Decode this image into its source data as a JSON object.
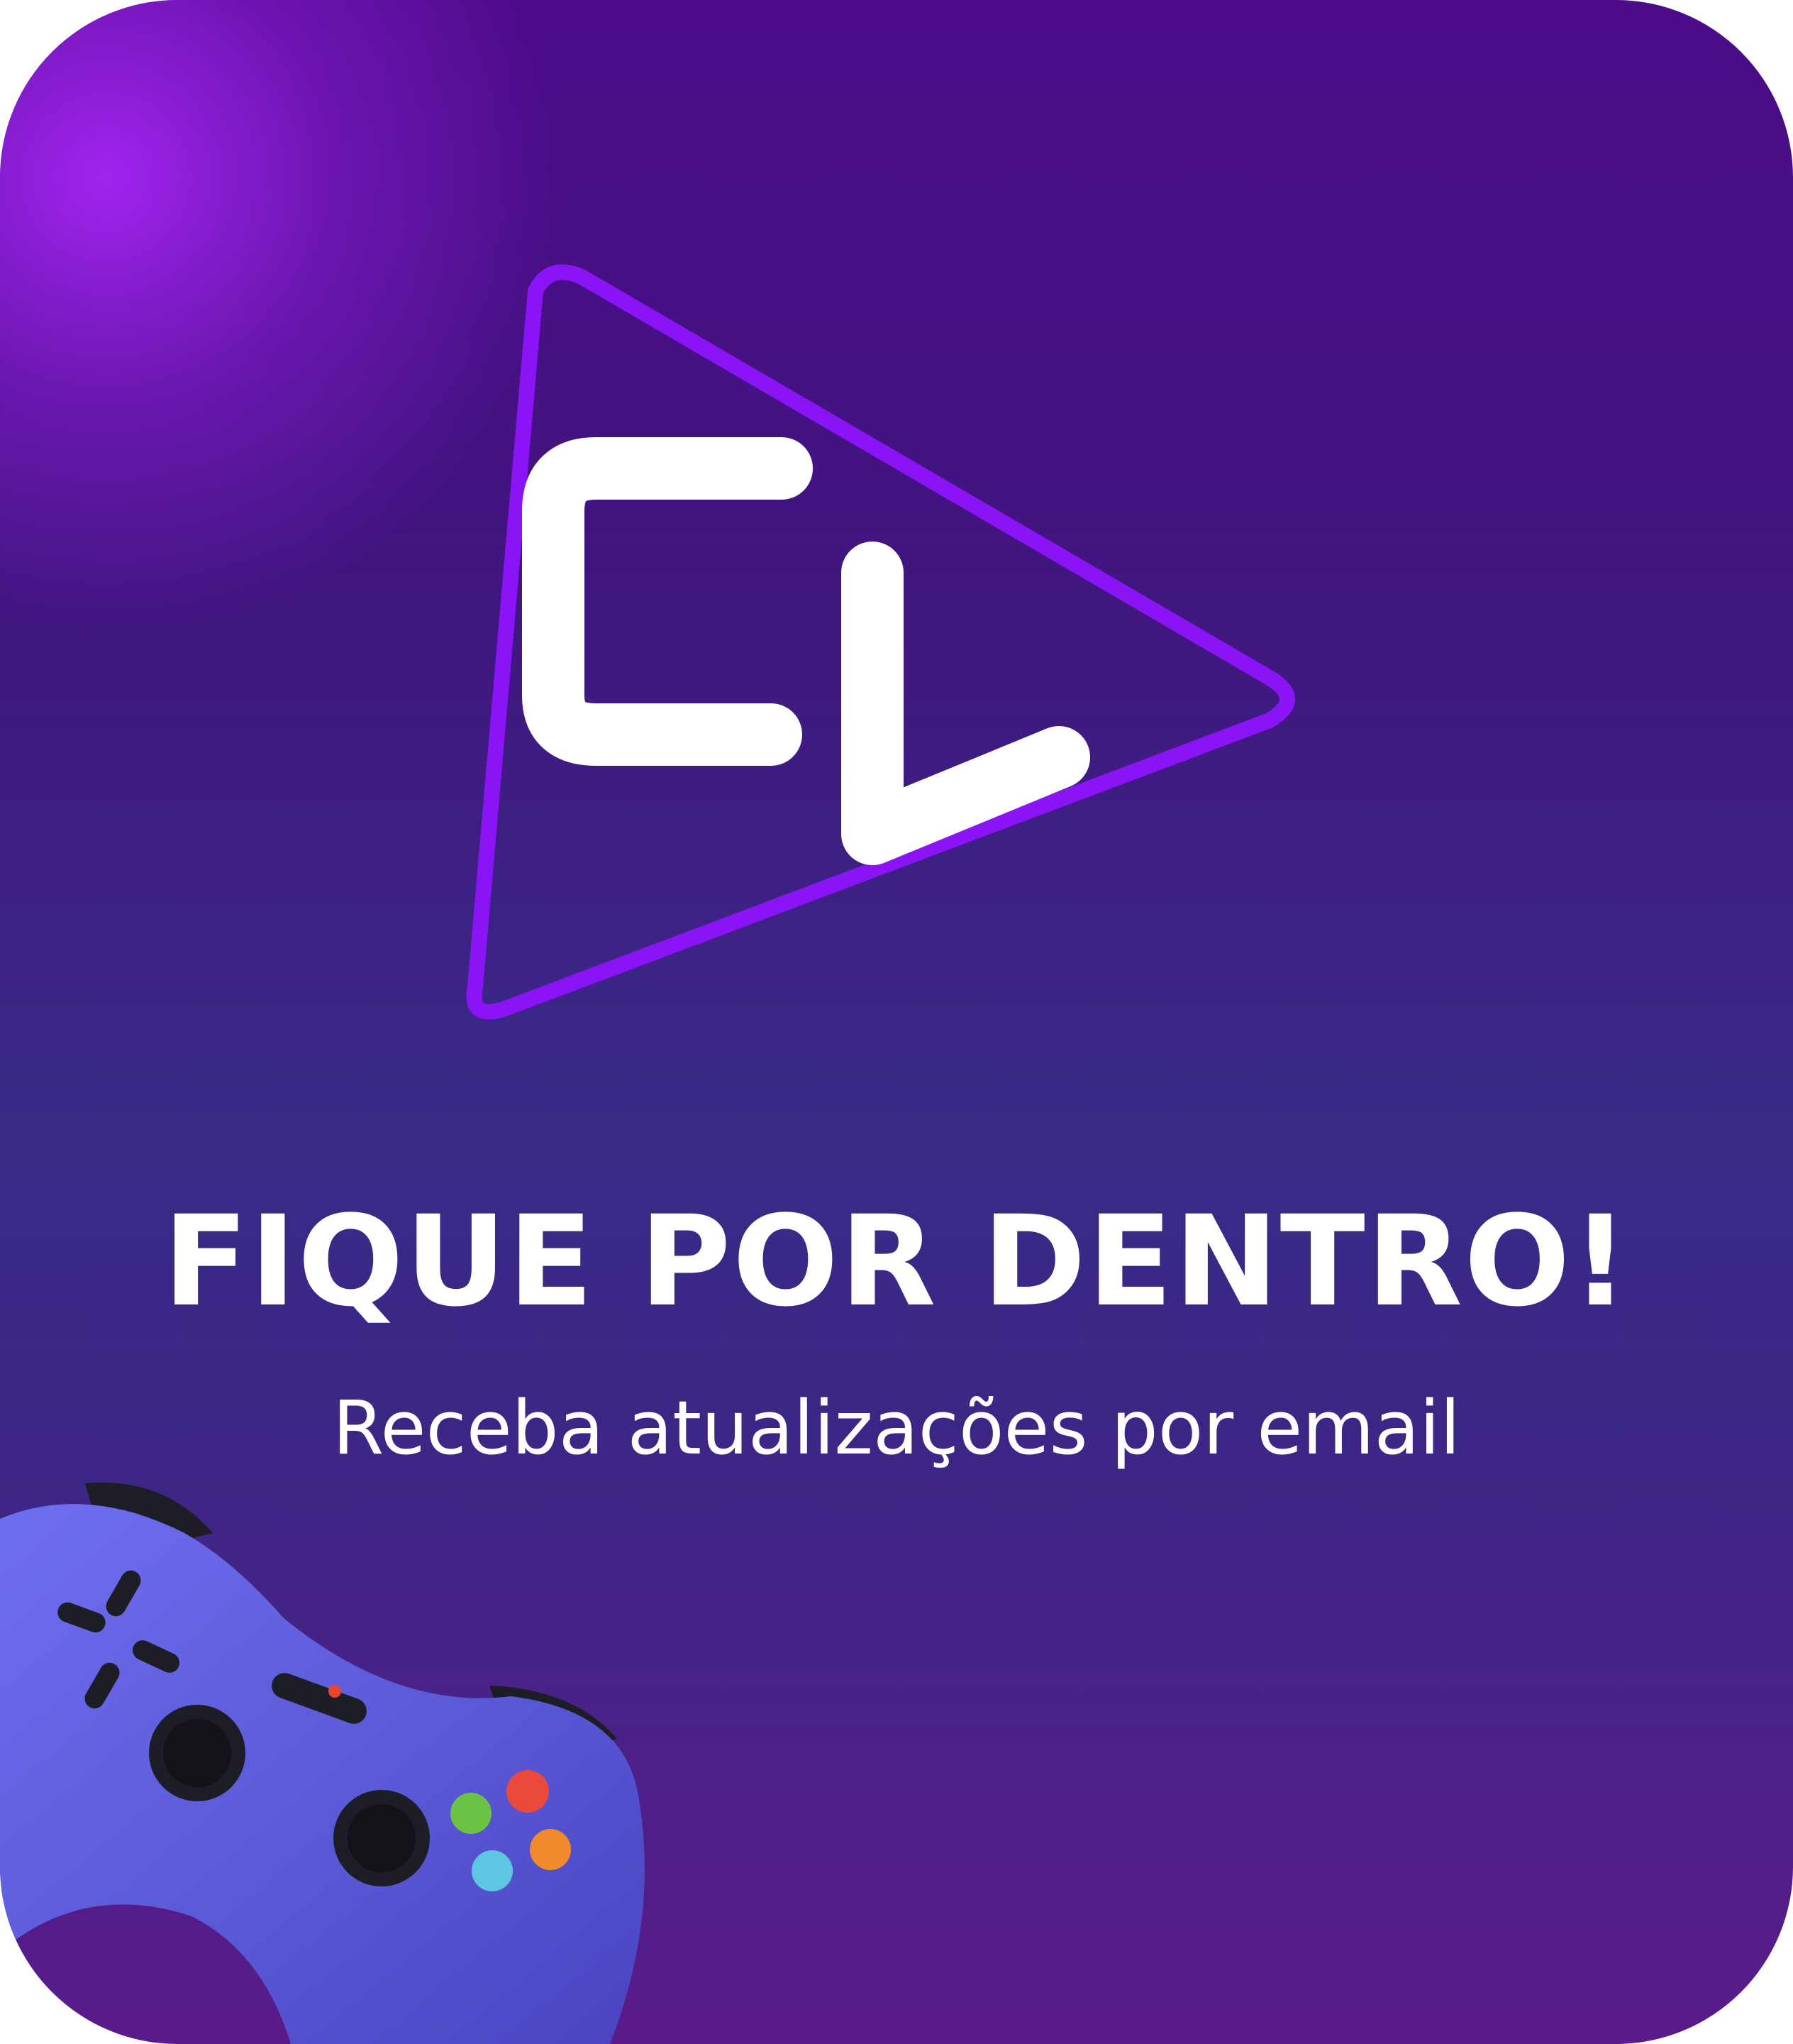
{
  "brand": {
    "logo_letters": "CL",
    "logo_outline_color": "#8a14f5"
  },
  "headline": "FIQUE POR DENTRO!",
  "subline": "Receba atualizações por email",
  "colors": {
    "background_top": "#4c0b88",
    "background_mid": "#392a86",
    "background_bottom": "#5a1a8a",
    "text": "#ffffff",
    "controller_body": "#5b5ad6"
  },
  "controller_buttons": [
    "red",
    "green",
    "orange",
    "cyan"
  ]
}
